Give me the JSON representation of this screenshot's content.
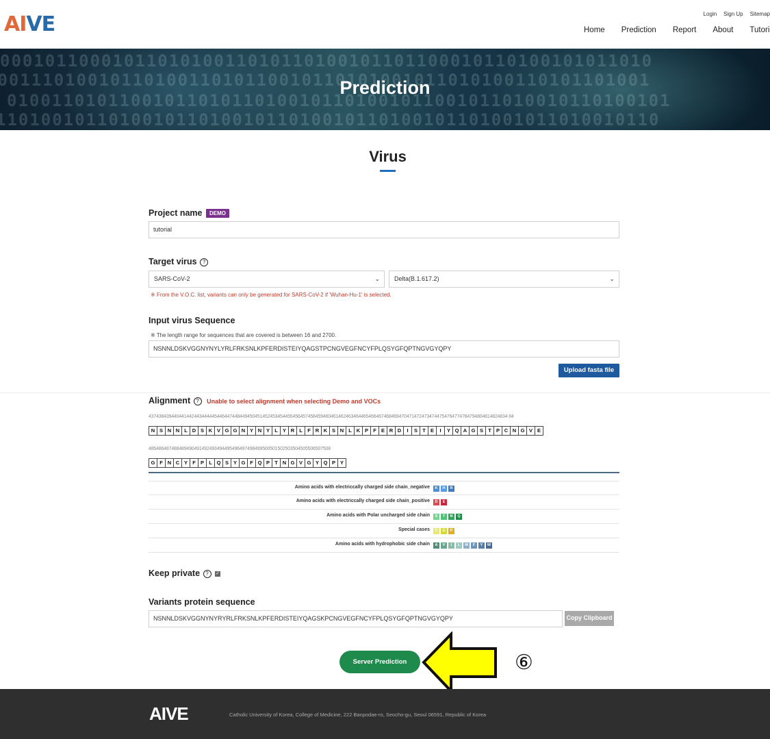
{
  "header": {
    "logo_a": "AI",
    "logo_v": "V",
    "logo_e": "E",
    "util_links": [
      "Login",
      "Sign Up",
      "Sitemap"
    ],
    "nav": [
      "Home",
      "Prediction",
      "Report",
      "About",
      "Tutorial"
    ]
  },
  "banner": {
    "title": "Prediction"
  },
  "section": {
    "title": "Virus"
  },
  "project": {
    "label": "Project name",
    "badge": "DEMO",
    "value": "tutorial"
  },
  "target": {
    "label": "Target virus",
    "help": "?",
    "virus": "SARS-CoV-2",
    "variant": "Delta(B.1.617.2)",
    "note": "※ From the V.O.C. list, variants can only be generated for SARS-CoV-2 if 'Wuhan-Hu-1' is selected."
  },
  "input_seq": {
    "label": "Input virus Sequence",
    "note": "※ The length range for sequences that are covered is between 16 and 2700.",
    "value": "NSNNLDSKVGGNYNYLYRLFRKSNLKPFERDISTEIYQAGSTPCNGVEGFNCYFPLQSYGFQPTNGVGYQPY",
    "upload_label": "Upload fasta file"
  },
  "alignment": {
    "label": "Alignment",
    "help": "?",
    "warning": "Unable to select alignment when selecting Demo and VOCs",
    "positions_1": "4374384394404414424434444454464474484494504514524534544554564574584594604614624634644654664674684694704714724734744754764774784794804814824834 84",
    "residues_1": [
      "N",
      "S",
      "N",
      "N",
      "L",
      "D",
      "S",
      "K",
      "V",
      "G",
      "G",
      "N",
      "Y",
      "N",
      "Y",
      "L",
      "Y",
      "R",
      "L",
      "F",
      "R",
      "K",
      "S",
      "N",
      "L",
      "K",
      "P",
      "F",
      "E",
      "R",
      "D",
      "I",
      "S",
      "T",
      "E",
      "I",
      "Y",
      "Q",
      "A",
      "G",
      "S",
      "T",
      "P",
      "C",
      "N",
      "G",
      "V",
      "E"
    ],
    "positions_2": "485486487488489490491492493494495496497498499500501502503504505506507508",
    "residues_2": [
      "G",
      "F",
      "N",
      "C",
      "Y",
      "F",
      "P",
      "L",
      "Q",
      "S",
      "Y",
      "G",
      "F",
      "Q",
      "P",
      "T",
      "N",
      "G",
      "V",
      "G",
      "Y",
      "Q",
      "P",
      "Y"
    ]
  },
  "legend": [
    {
      "label": "Amino acids with electriccally charged side chain_negative",
      "chips": [
        {
          "t": "K",
          "c": "#4a90d9"
        },
        {
          "t": "H",
          "c": "#5b9be6"
        },
        {
          "t": "R",
          "c": "#3b7cc4"
        }
      ]
    },
    {
      "label": "Amino acids with electriccally charged side chain_positive",
      "chips": [
        {
          "t": "D",
          "c": "#e0474c"
        },
        {
          "t": "E",
          "c": "#c8263a"
        }
      ]
    },
    {
      "label": "Amino acids with Polar uncharged side chain",
      "chips": [
        {
          "t": "S",
          "c": "#6fd68f"
        },
        {
          "t": "T",
          "c": "#4cc474"
        },
        {
          "t": "N",
          "c": "#2ea65a"
        },
        {
          "t": "Q",
          "c": "#1f8a48"
        }
      ]
    },
    {
      "label": "Special cases",
      "chips": [
        {
          "t": "C",
          "c": "#e8e86a"
        },
        {
          "t": "G",
          "c": "#d8d83a"
        },
        {
          "t": "P",
          "c": "#e0b020"
        }
      ]
    },
    {
      "label": "Amino acids with hydrophobic side chain",
      "chips": [
        {
          "t": "A",
          "c": "#4e8f76"
        },
        {
          "t": "V",
          "c": "#6aa58d"
        },
        {
          "t": "I",
          "c": "#8bbca8"
        },
        {
          "t": "L",
          "c": "#9ec9c0"
        },
        {
          "t": "M",
          "c": "#8db0c6"
        },
        {
          "t": "F",
          "c": "#6d95b5"
        },
        {
          "t": "Y",
          "c": "#5a7fa6"
        },
        {
          "t": "W",
          "c": "#496b8f"
        }
      ]
    }
  ],
  "privacy": {
    "label": "Keep private",
    "help": "?",
    "check": "✓"
  },
  "variants": {
    "label": "Variants protein sequence",
    "value": "NSNNLDSKVGGNYNYRYRLFRKSNLKPFERDISTEIYQAGSKPCNGVEGFNCYFPLQSYGFQPTNGVGYQPY",
    "copy_label": "Copy Clipboard"
  },
  "submit": {
    "label": "Server Prediction"
  },
  "annotation": {
    "step": "⑥"
  },
  "footer": {
    "logo": "AIVE",
    "address": "Catholic University of Korea, College of Medicine, 222 Banpodae-ro, Seocho-gu, Seoul 06591, Republic of Korea"
  },
  "colors": {
    "nav_text": "#222222",
    "banner_dark": "#0e2030",
    "accent_blue": "#1e6fbf",
    "button_blue": "#1f5a9e",
    "button_green": "#1e8a4c",
    "demo_purple": "#7b2f8f",
    "warning_red": "#c0392b",
    "arrow_yellow": "#ffff00",
    "footer_bg": "#2f2f2f"
  }
}
